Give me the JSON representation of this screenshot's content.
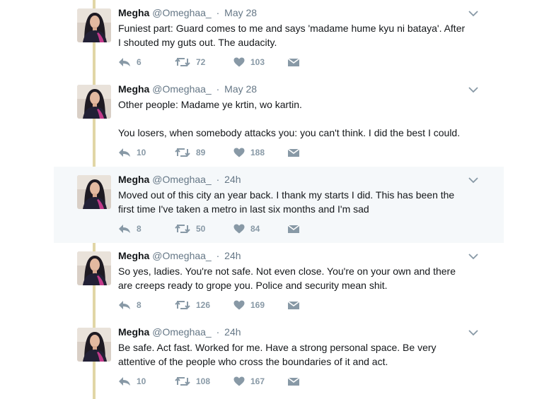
{
  "tweets": [
    {
      "name": "Megha",
      "handle": "@Omeghaa_",
      "sep": "·",
      "time": "May 28",
      "text": "Funiest part: Guard comes to me and says 'madame hume kyu ni bataya'. After\nI shouted my guts out. The audacity.",
      "replies": "6",
      "retweets": "72",
      "likes": "103",
      "highlighted": false
    },
    {
      "name": "Megha",
      "handle": "@Omeghaa_",
      "sep": "·",
      "time": "May 28",
      "text": "Other people: Madame ye krtin, wo kartin.\n\nYou losers, when somebody attacks you: you can't think. I did the best I could.",
      "replies": "10",
      "retweets": "89",
      "likes": "188",
      "highlighted": false
    },
    {
      "name": "Megha",
      "handle": "@Omeghaa_",
      "sep": "·",
      "time": "24h",
      "text": "Moved out of this city an year back. I thank my starts I did. This has been the\nfirst time I've taken a metro in last six months and I'm sad",
      "replies": "8",
      "retweets": "50",
      "likes": "84",
      "highlighted": true
    },
    {
      "name": "Megha",
      "handle": "@Omeghaa_",
      "sep": "·",
      "time": "24h",
      "text": "So yes, ladies. You're not safe. Not even close. You're on your own and there\nare creeps ready to grope you. Police and security mean shit.",
      "replies": "8",
      "retweets": "126",
      "likes": "169",
      "highlighted": false
    },
    {
      "name": "Megha",
      "handle": "@Omeghaa_",
      "sep": "·",
      "time": "24h",
      "text": "Be safe. Act fast. Worked for me. Have a strong personal space. Be very\nattentive of the people who cross the boundaries of it and act.",
      "replies": "10",
      "retweets": "108",
      "likes": "167",
      "highlighted": false
    }
  ],
  "colors": {
    "thread_line": "#e1d6a6",
    "highlight_bg": "#f5f8fa",
    "meta_gray": "#657786",
    "icon_gray": "#8899a6"
  },
  "icons": {
    "reply": "reply-icon",
    "retweet": "retweet-icon",
    "like": "heart-icon",
    "dm": "envelope-icon",
    "more": "chevron-down-icon"
  }
}
